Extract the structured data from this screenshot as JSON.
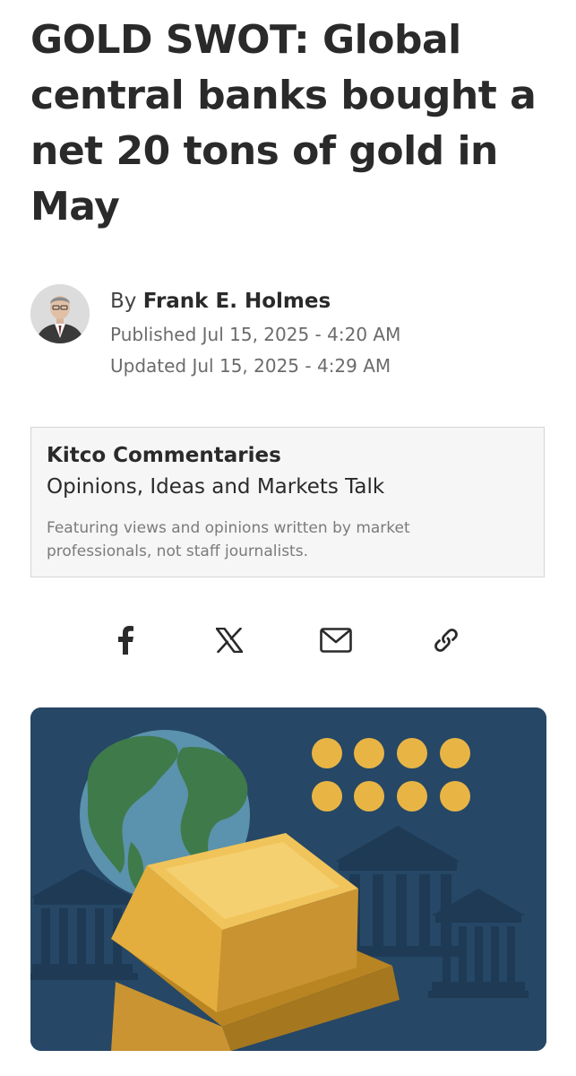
{
  "article": {
    "headline": "GOLD SWOT: Global central banks bought a net 20 tons of gold in May"
  },
  "author": {
    "by_prefix": "By",
    "name": "Frank E. Holmes",
    "published": "Published Jul 15, 2025 - 4:20 AM",
    "updated": "Updated Jul 15, 2025 - 4:29 AM"
  },
  "commentary": {
    "title": "Kitco Commentaries",
    "subtitle": "Opinions, Ideas and Markets Talk",
    "description": "Featuring views and opinions written by market professionals, not staff journalists."
  },
  "share": {
    "icons": [
      "facebook-icon",
      "x-icon",
      "mail-icon",
      "link-icon"
    ]
  },
  "colors": {
    "hero_background": "#264766",
    "gold": "#e8b545",
    "text_dark": "#2a2a2a",
    "text_muted": "#6b6b6b",
    "box_background": "#f6f6f6"
  }
}
